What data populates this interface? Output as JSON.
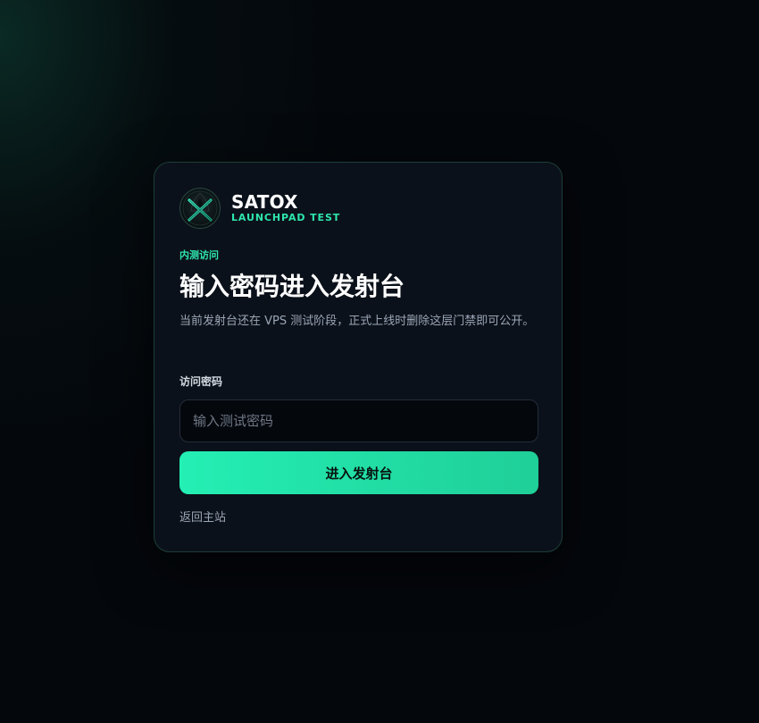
{
  "brand": {
    "name": "SATOX",
    "subtitle": "LAUNCHPAD TEST",
    "logo_icon": "satox-x-logo-icon"
  },
  "gate": {
    "eyebrow": "内测访问",
    "title": "输入密码进入发射台",
    "description": "当前发射台还在 VPS 测试阶段，正式上线时删除这层门禁即可公开。"
  },
  "form": {
    "password_label": "访问密码",
    "password_placeholder": "输入测试密码",
    "password_value": "",
    "submit_label": "进入发射台"
  },
  "footer": {
    "back_link_label": "返回主站"
  },
  "colors": {
    "accent": "#2ee6ad",
    "button_start": "#24efb4",
    "button_end": "#1fcf98",
    "card_background": "#0b111a",
    "card_border": "#1d3e37",
    "page_background": "#04070c"
  }
}
